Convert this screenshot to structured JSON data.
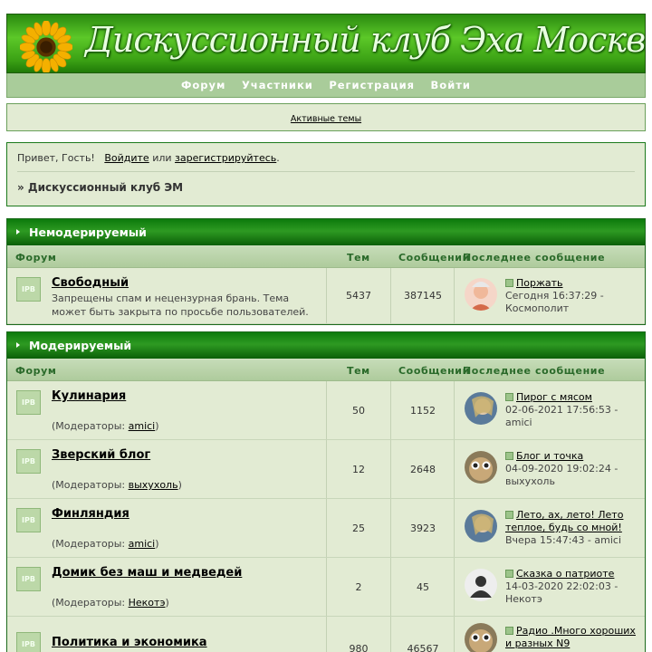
{
  "header": {
    "logo_title": "Дискуссионный клуб Эха Москвы",
    "nav": [
      "Форум",
      "Участники",
      "Регистрация",
      "Войти"
    ]
  },
  "active_topics_link": "Активные темы",
  "userbox": {
    "greeting": "Привет, Гость!",
    "login_link": "Войдите",
    "or_text": "или",
    "register_link": "зарегистрируйтесь",
    "end_dot": ".",
    "breadcrumb": "» Дискуссионный клуб ЭМ"
  },
  "columns": {
    "forum": "Форум",
    "topics": "Тем",
    "posts": "Сообщений",
    "last": "Последнее сообщение"
  },
  "icon_label": "IPB",
  "categories": [
    {
      "title": "Немодерируемый",
      "forums": [
        {
          "name": "Свободный",
          "desc": "Запрещены спам и нецензурная брань. Тема может быть закрыта по просьбе пользователей.",
          "topics": "5437",
          "posts": "387145",
          "last_title": "Поржать",
          "last_meta": "Сегодня 16:37:29 - Космополит"
        }
      ]
    },
    {
      "title": "Модерируемый",
      "forums": [
        {
          "name": "Кулинария",
          "mod_prefix": "(Модераторы:",
          "mod": "amici",
          "mod_suffix": ")",
          "topics": "50",
          "posts": "1152",
          "last_title": "Пирог с мясом",
          "last_meta": "02-06-2021 17:56:53 - amici"
        },
        {
          "name": "Зверский блог",
          "mod_prefix": "(Модераторы:",
          "mod": "выхухоль",
          "mod_suffix": ")",
          "topics": "12",
          "posts": "2648",
          "last_title": "Блог и точка",
          "last_meta": "04-09-2020 19:02:24 - выхухоль"
        },
        {
          "name": "Финляндия",
          "mod_prefix": "(Модераторы:",
          "mod": "amici",
          "mod_suffix": ")",
          "topics": "25",
          "posts": "3923",
          "last_title": "Лето, ах, лето! Лето теплое, будь со мной!",
          "last_meta": "Вчера 15:47:43 - amici"
        },
        {
          "name": "Домик без маш и медведей",
          "mod_prefix": "(Модераторы:",
          "mod": "Некотэ",
          "mod_suffix": ")",
          "topics": "2",
          "posts": "45",
          "last_title": "Сказка о патриоте",
          "last_meta": "14-03-2020 22:02:03 - Некотэ"
        },
        {
          "name": "Политика и экономика",
          "topics": "980",
          "posts": "46567",
          "last_title": "Радио .Много хороших и разных N9",
          "last_meta": ""
        }
      ]
    }
  ],
  "colors": {
    "header_green": "#2e9a22",
    "panel_bg": "#e2ebd3",
    "nav_bg": "#a9cc9a"
  }
}
